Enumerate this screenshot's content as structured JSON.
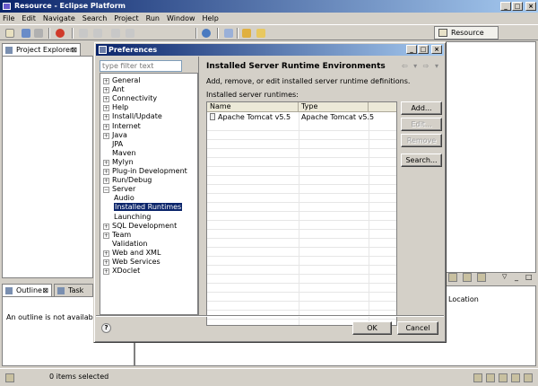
{
  "window": {
    "title": "Resource - Eclipse Platform"
  },
  "menu": [
    "File",
    "Edit",
    "Navigate",
    "Search",
    "Project",
    "Run",
    "Window",
    "Help"
  ],
  "perspective": {
    "label": "Resource"
  },
  "views": {
    "project_explorer_tab": "Project Explorer",
    "outline_tab": "Outline",
    "tasks_tab": "Task Lis",
    "outline_message": "An outline is not available.",
    "location_header": "Location"
  },
  "status": {
    "text": "0 items selected"
  },
  "dialog": {
    "title": "Preferences",
    "filter_placeholder": "type filter text",
    "tree": [
      {
        "label": "General",
        "expandable": true,
        "level": 0
      },
      {
        "label": "Ant",
        "expandable": true,
        "level": 0
      },
      {
        "label": "Connectivity",
        "expandable": true,
        "level": 0
      },
      {
        "label": "Help",
        "expandable": true,
        "level": 0
      },
      {
        "label": "Install/Update",
        "expandable": true,
        "level": 0
      },
      {
        "label": "Internet",
        "expandable": true,
        "level": 0
      },
      {
        "label": "Java",
        "expandable": true,
        "level": 0
      },
      {
        "label": "JPA",
        "expandable": false,
        "level": 0
      },
      {
        "label": "Maven",
        "expandable": false,
        "level": 0
      },
      {
        "label": "Mylyn",
        "expandable": true,
        "level": 0
      },
      {
        "label": "Plug-in Development",
        "expandable": true,
        "level": 0
      },
      {
        "label": "Run/Debug",
        "expandable": true,
        "level": 0
      },
      {
        "label": "Server",
        "expandable": true,
        "expanded": true,
        "level": 0
      },
      {
        "label": "Audio",
        "expandable": false,
        "level": 1
      },
      {
        "label": "Installed Runtimes",
        "expandable": false,
        "level": 1,
        "selected": true
      },
      {
        "label": "Launching",
        "expandable": false,
        "level": 1
      },
      {
        "label": "SQL Development",
        "expandable": true,
        "level": 0
      },
      {
        "label": "Team",
        "expandable": true,
        "level": 0
      },
      {
        "label": "Validation",
        "expandable": false,
        "level": 0
      },
      {
        "label": "Web and XML",
        "expandable": true,
        "level": 0
      },
      {
        "label": "Web Services",
        "expandable": true,
        "level": 0
      },
      {
        "label": "XDoclet",
        "expandable": true,
        "level": 0
      }
    ],
    "page_title": "Installed Server Runtime Environments",
    "description": "Add, remove, or edit installed server runtime definitions.",
    "table_label": "Installed server runtimes:",
    "columns": [
      "Name",
      "Type"
    ],
    "rows": [
      {
        "name": "Apache Tomcat v5.5",
        "type": "Apache Tomcat v5.5"
      }
    ],
    "buttons": {
      "add": "Add...",
      "edit": "Edit...",
      "remove": "Remove",
      "search": "Search...",
      "ok": "OK",
      "cancel": "Cancel"
    }
  }
}
